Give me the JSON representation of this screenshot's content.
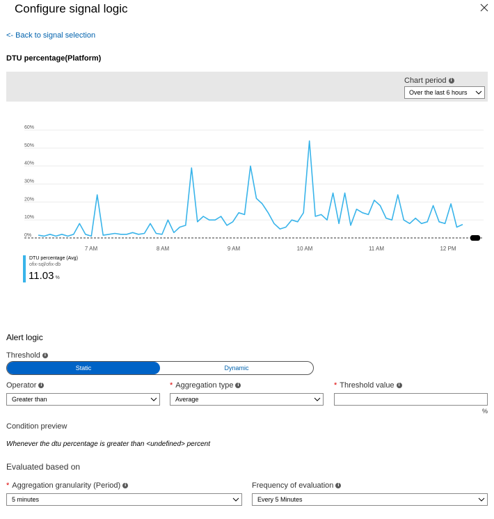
{
  "panel": {
    "title": "Configure signal logic",
    "back_link": "<- Back to signal selection",
    "signal_name": "DTU percentage(Platform)"
  },
  "chart_period": {
    "label": "Chart period",
    "selected": "Over the last 6 hours"
  },
  "chart_data": {
    "type": "line",
    "y_ticks": [
      "60%",
      "50%",
      "40%",
      "30%",
      "20%",
      "10%",
      "0%"
    ],
    "ylim": [
      0,
      60
    ],
    "x_ticks": [
      "7 AM",
      "8 AM",
      "9 AM",
      "10 AM",
      "11 AM",
      "12 PM"
    ],
    "series": [
      {
        "name": "DTU percentage (Avg)",
        "color": "#39b4ea",
        "values": [
          1.5,
          1,
          2,
          1,
          2,
          1,
          2,
          8,
          2,
          1,
          24,
          1.5,
          2,
          2.5,
          2,
          2,
          3,
          2,
          2.5,
          8,
          2.5,
          2,
          10,
          3,
          6,
          7,
          39,
          9,
          12,
          10,
          10,
          12,
          7,
          9,
          14,
          13,
          40,
          22,
          19,
          14,
          8,
          5,
          6,
          10,
          9,
          14,
          54,
          12,
          13,
          10,
          25,
          8,
          25,
          7,
          16,
          14,
          13,
          21,
          18,
          11,
          10,
          24,
          10,
          8,
          11,
          8,
          9,
          18,
          9,
          8,
          19,
          6,
          7.5
        ]
      }
    ],
    "threshold_line": 0
  },
  "legend": {
    "metric": "DTU percentage (Avg)",
    "resource": "ofix-sql/ofix-db",
    "value": "11.03",
    "unit": "%"
  },
  "alert_logic": {
    "heading": "Alert logic",
    "threshold_label": "Threshold",
    "threshold_options": [
      "Static",
      "Dynamic"
    ],
    "threshold_selected": "Static",
    "operator_label": "Operator",
    "operator_value": "Greater than",
    "aggregation_label": "Aggregation type",
    "aggregation_value": "Average",
    "threshold_value_label": "Threshold value",
    "threshold_value": "",
    "threshold_unit": "%"
  },
  "condition": {
    "heading": "Condition preview",
    "text": "Whenever the dtu percentage is greater than <undefined> percent"
  },
  "evaluation": {
    "heading": "Evaluated based on",
    "granularity_label": "Aggregation granularity (Period)",
    "granularity_value": "5 minutes",
    "frequency_label": "Frequency of evaluation",
    "frequency_value": "Every 5 Minutes"
  },
  "icons": {
    "close": "close-icon",
    "info": "info-icon",
    "chevron": "chevron-down-icon"
  }
}
